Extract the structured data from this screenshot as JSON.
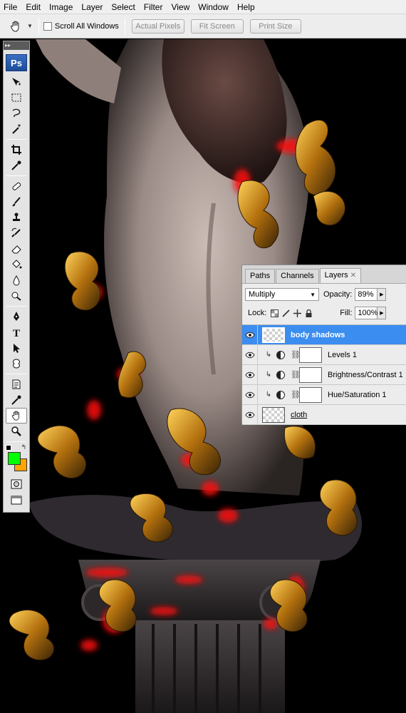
{
  "menu": [
    "File",
    "Edit",
    "Image",
    "Layer",
    "Select",
    "Filter",
    "View",
    "Window",
    "Help"
  ],
  "options_bar": {
    "tool_icon": "hand-tool-icon",
    "scroll_all_label": "Scroll All Windows",
    "scroll_all_checked": false,
    "actual_pixels": "Actual Pixels",
    "fit_screen": "Fit Screen",
    "print_size": "Print Size"
  },
  "toolbox": {
    "logo": "Ps",
    "tools": [
      "move-tool-icon",
      "marquee-tool-icon",
      "lasso-tool-icon",
      "magic-wand-tool-icon",
      "crop-tool-icon",
      "eyedropper-tool-icon",
      "healing-brush-tool-icon",
      "brush-tool-icon",
      "clone-stamp-tool-icon",
      "history-brush-tool-icon",
      "eraser-tool-icon",
      "paint-bucket-tool-icon",
      "blur-tool-icon",
      "dodge-tool-icon",
      "pen-tool-icon",
      "type-tool-icon",
      "path-selection-tool-icon",
      "custom-shape-tool-icon",
      "notes-tool-icon",
      "eyedropper-tool-icon",
      "hand-tool-icon",
      "zoom-tool-icon"
    ],
    "foreground_color": "#00ff00",
    "background_color": "#ffa500"
  },
  "layers_panel": {
    "tabs": [
      "Paths",
      "Channels",
      "Layers"
    ],
    "active_tab": "Layers",
    "blend_mode": "Multiply",
    "opacity_label": "Opacity:",
    "opacity": "89%",
    "lock_label": "Lock:",
    "fill_label": "Fill:",
    "fill": "100%",
    "layers": [
      {
        "name": "body shadows",
        "selected": true,
        "type": "pixel"
      },
      {
        "name": "Levels 1",
        "selected": false,
        "type": "adjustment"
      },
      {
        "name": "Brightness/Contrast 1",
        "selected": false,
        "type": "adjustment"
      },
      {
        "name": "Hue/Saturation 1",
        "selected": false,
        "type": "adjustment"
      },
      {
        "name": "cloth",
        "selected": false,
        "type": "pixel"
      }
    ]
  }
}
